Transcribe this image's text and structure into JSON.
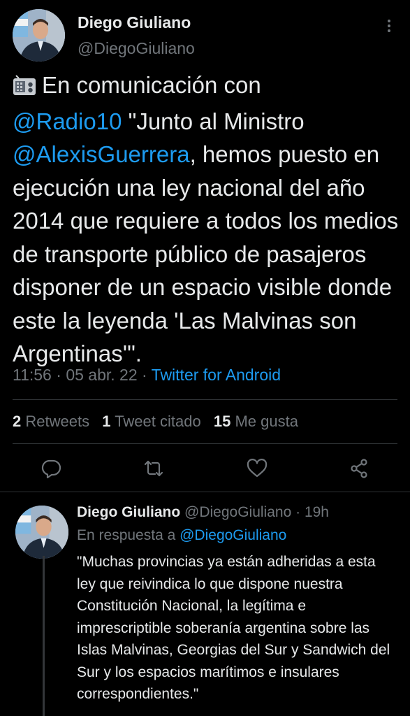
{
  "tweet": {
    "author_name": "Diego Giuliano",
    "author_handle": "@DiegoGiuliano",
    "icon_radio": "radio-icon",
    "text_before_mention1": "En comunicación con",
    "mention1": "@Radio10",
    "text_after_mention1": "\"Junto al Ministro",
    "mention2": "@AlexisGuerrera",
    "text_after_mention2": ", hemos puesto en ejecución una ley nacional del año 2014 que requiere a todos los medios de transporte público de pasajeros disponer de un espacio visible donde este la leyenda 'Las Malvinas son Argentinas'\".",
    "time": "11:56",
    "date": "05 abr. 22",
    "separator": "·",
    "source": "Twitter for Android"
  },
  "stats": {
    "retweets_count": "2",
    "retweets_label": "Retweets",
    "quotes_count": "1",
    "quotes_label": "Tweet citado",
    "likes_count": "15",
    "likes_label": "Me gusta"
  },
  "actions": [
    "reply-icon",
    "retweet-icon",
    "like-icon",
    "share-icon"
  ],
  "reply": {
    "author_name": "Diego Giuliano",
    "author_handle": "@DiegoGiuliano",
    "separator": "·",
    "age": "19h",
    "replying_to_label": "En respuesta a",
    "replying_to_handle": "@DiegoGiuliano",
    "text": "\"Muchas provincias ya están adheridas a esta ley que reivindica lo que dispone nuestra Constitución Nacional, la legítima e imprescriptible soberanía argentina sobre las Islas Malvinas, Georgias del Sur y Sandwich del Sur y los espacios marítimos e insulares correspondientes.\""
  },
  "colors": {
    "background": "#000000",
    "text": "#e7e9ea",
    "muted": "#71767b",
    "link": "#1d9bf0",
    "divider": "#2f3336"
  }
}
